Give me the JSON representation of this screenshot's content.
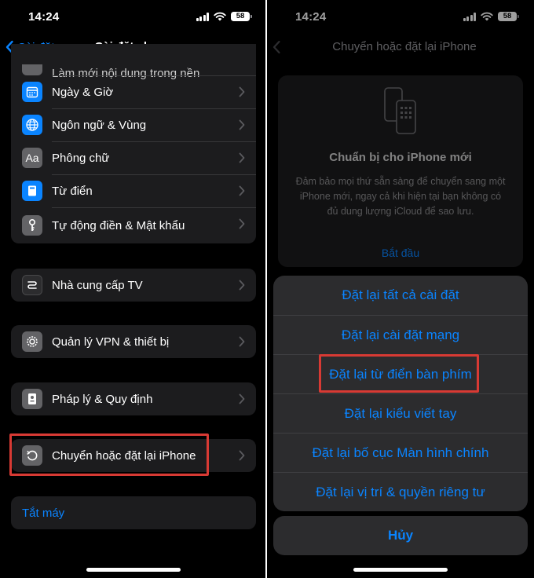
{
  "left": {
    "status": {
      "time": "14:24",
      "battery": "58"
    },
    "nav": {
      "back_label": "Cài đặt",
      "title": "Cài đặt chung"
    },
    "group1": [
      {
        "label": "Làm mới nội dung trong nền",
        "icon": "gear-icon",
        "color": "#636366"
      },
      {
        "label": "Ngày & Giờ",
        "icon": "calendar-icon",
        "color": "#0a84ff"
      },
      {
        "label": "Ngôn ngữ & Vùng",
        "icon": "globe-icon",
        "color": "#0a84ff"
      },
      {
        "label": "Phông chữ",
        "icon": "font-icon",
        "color": "#636366"
      },
      {
        "label": "Từ điển",
        "icon": "book-icon",
        "color": "#0a84ff"
      },
      {
        "label": "Tự động điền & Mật khẩu",
        "icon": "key-icon",
        "color": "#636366"
      }
    ],
    "tv_provider": {
      "label": "Nhà cung cấp TV",
      "icon": "tv-provider-icon"
    },
    "vpn": {
      "label": "Quản lý VPN & thiết bị",
      "icon": "gear-icon"
    },
    "legal": {
      "label": "Pháp lý & Quy định",
      "icon": "legal-icon"
    },
    "transfer_reset": {
      "label": "Chuyển hoặc đặt lại iPhone",
      "icon": "reset-icon"
    },
    "shutdown": {
      "label": "Tắt máy"
    }
  },
  "right": {
    "status": {
      "time": "14:24",
      "battery": "58"
    },
    "nav": {
      "title": "Chuyển hoặc đặt lại iPhone"
    },
    "card": {
      "title": "Chuẩn bị cho iPhone mới",
      "description": "Đảm bảo mọi thứ sẵn sàng để chuyển sang một iPhone mới, ngay cả khi hiện tại bạn không có đủ dung lượng iCloud để sao lưu.",
      "start_label": "Bắt đầu"
    },
    "reset_options": [
      "Đặt lại tất cả cài đặt",
      "Đặt lại cài đặt mạng",
      "Đặt lại từ điển bàn phím",
      "Đặt lại kiểu viết tay",
      "Đặt lại bố cục Màn hình chính",
      "Đặt lại vị trí & quyền riêng tư"
    ],
    "cancel_label": "Hủy"
  },
  "colors": {
    "accent": "#0a84ff",
    "highlight": "#d83a34",
    "cell": "#1c1c1e"
  }
}
